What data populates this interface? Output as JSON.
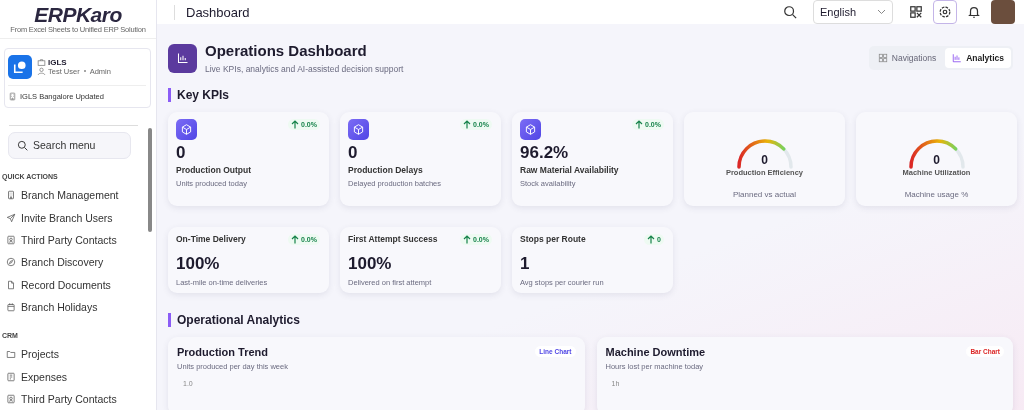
{
  "sidebar": {
    "logo": {
      "name": "ERPKaro",
      "tagline": "From Excel Sheets to Unified ERP Solution"
    },
    "org": {
      "company": "IGLS",
      "user": "Test User",
      "role": "Admin",
      "branch": "IGLS Bangalore Updated"
    },
    "search": {
      "placeholder": "Search menu"
    },
    "sections": [
      {
        "title": "QUICK ACTIONS",
        "items": [
          {
            "label": "Branch Management",
            "kind": "building"
          },
          {
            "label": "Invite Branch Users",
            "kind": "send"
          },
          {
            "label": "Third Party Contacts",
            "kind": "contact"
          },
          {
            "label": "Branch Discovery",
            "kind": "compass"
          },
          {
            "label": "Record Documents",
            "kind": "file"
          },
          {
            "label": "Branch Holidays",
            "kind": "calendar"
          }
        ]
      },
      {
        "title": "CRM",
        "items": [
          {
            "label": "Projects",
            "kind": "folder"
          },
          {
            "label": "Expenses",
            "kind": "receipt"
          },
          {
            "label": "Third Party Contacts",
            "kind": "contact"
          }
        ]
      }
    ]
  },
  "header": {
    "title": "Dashboard",
    "language": "English"
  },
  "page": {
    "title": "Operations Dashboard",
    "subtitle": "Live KPIs, analytics and AI-assisted decision support",
    "tabs": [
      {
        "label": "Navigations",
        "selected": false
      },
      {
        "label": "Analytics",
        "selected": true
      }
    ]
  },
  "kpi_section": "Key KPIs",
  "kpi_cards": [
    {
      "kind": "metric",
      "value": "0",
      "title": "Production Output",
      "caption": "Units produced today",
      "change": "0.0%"
    },
    {
      "kind": "metric",
      "value": "0",
      "title": "Production Delays",
      "caption": "Delayed production batches",
      "change": "0.0%"
    },
    {
      "kind": "metric",
      "value": "96.2%",
      "title": "Raw Material Availability",
      "caption": "Stock availability",
      "change": "0.0%"
    },
    {
      "kind": "gauge",
      "value": "0",
      "title": "Production Efficiency",
      "caption": "Planned vs actual"
    },
    {
      "kind": "gauge",
      "value": "0",
      "title": "Machine Utilization",
      "caption": "Machine usage %"
    }
  ],
  "delivery_cards": [
    {
      "title": "On-Time Delivery",
      "value": "100%",
      "caption": "Last-mile on-time deliveries",
      "change": "0.0%"
    },
    {
      "title": "First Attempt Success",
      "value": "100%",
      "caption": "Delivered on first attempt",
      "change": "0.0%"
    },
    {
      "title": "Stops per Route",
      "value": "1",
      "caption": "Avg stops per courier run",
      "change": "0"
    }
  ],
  "analytics_section": "Operational Analytics",
  "charts": [
    {
      "title": "Production Trend",
      "subtitle": "Units produced per day this week",
      "badge": "Line Chart",
      "kind": "line",
      "tick": "1.0"
    },
    {
      "title": "Machine Downtime",
      "subtitle": "Hours lost per machine today",
      "badge": "Bar Chart",
      "kind": "bar",
      "tick": "1h"
    }
  ]
}
